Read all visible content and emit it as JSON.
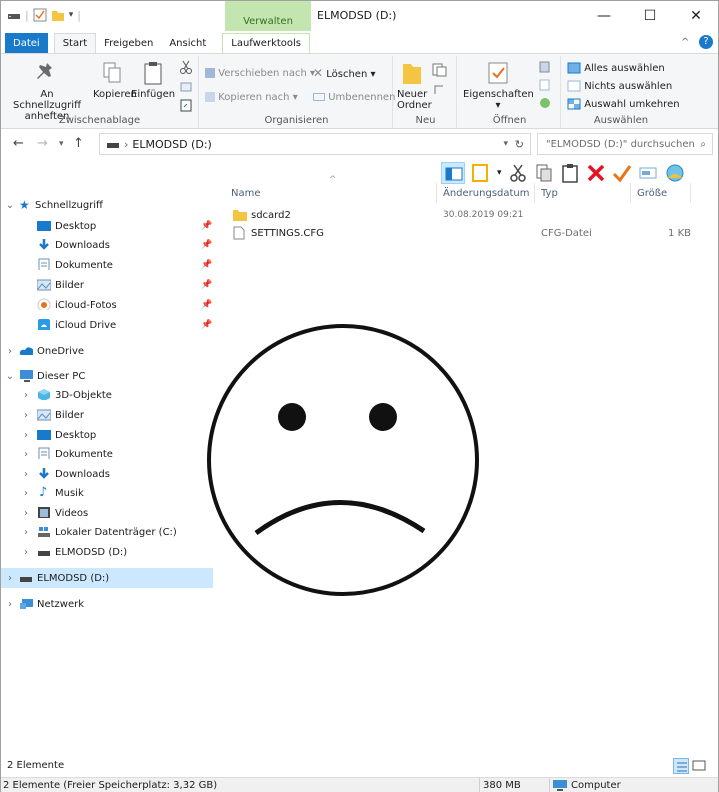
{
  "window": {
    "title": "ELMODSD (D:)",
    "context_header": "Verwalten",
    "minimize": "—",
    "maximize": "☐",
    "close": "✕"
  },
  "tabs": {
    "datei": "Datei",
    "start": "Start",
    "freigeben": "Freigeben",
    "ansicht": "Ansicht",
    "laufwerktools": "Laufwerktools"
  },
  "ribbon": {
    "clipboard": {
      "pin_label_1": "An Schnellzugriff",
      "pin_label_2": "anheften",
      "copy": "Kopieren",
      "paste": "Einfügen",
      "group": "Zwischenablage"
    },
    "organize": {
      "move_to": "Verschieben nach",
      "copy_to": "Kopieren nach",
      "delete": "Löschen",
      "rename": "Umbenennen",
      "group": "Organisieren"
    },
    "new": {
      "new_folder_1": "Neuer",
      "new_folder_2": "Ordner",
      "group": "Neu"
    },
    "open": {
      "properties": "Eigenschaften",
      "group": "Öffnen"
    },
    "select": {
      "select_all": "Alles auswählen",
      "select_none": "Nichts auswählen",
      "invert": "Auswahl umkehren",
      "group": "Auswählen"
    }
  },
  "address": {
    "path": "ELMODSD (D:)",
    "search_placeholder": "\"ELMODSD (D:)\" durchsuchen"
  },
  "nav": {
    "quick_access": "Schnellzugriff",
    "qa_items": [
      "Desktop",
      "Downloads",
      "Dokumente",
      "Bilder",
      "iCloud-Fotos",
      "iCloud Drive"
    ],
    "onedrive": "OneDrive",
    "this_pc": "Dieser PC",
    "pc_items": [
      "3D-Objekte",
      "Bilder",
      "Desktop",
      "Dokumente",
      "Downloads",
      "Musik",
      "Videos",
      "Lokaler Datenträger (C:)",
      "ELMODSD (D:)"
    ],
    "drive": "ELMODSD (D:)",
    "network": "Netzwerk"
  },
  "columns": {
    "name": "Name",
    "date": "Änderungsdatum",
    "type": "Typ",
    "size": "Größe"
  },
  "files": [
    {
      "name": "sdcard2",
      "date": "30.08.2019 09:21",
      "type": "",
      "size": ""
    },
    {
      "name": "SETTINGS.CFG",
      "date": "",
      "type": "CFG-Datei",
      "size": "1 KB"
    }
  ],
  "status": {
    "item_count": "2 Elemente",
    "free_space": "2 Elemente (Freier Speicherplatz: 3,32 GB)",
    "size": "380 MB",
    "location": "Computer"
  },
  "colors": {
    "accent": "#1979ca",
    "context": "#c3e6b1",
    "selected": "#cce8ff",
    "delete": "#e81123",
    "check": "#e8731a"
  }
}
